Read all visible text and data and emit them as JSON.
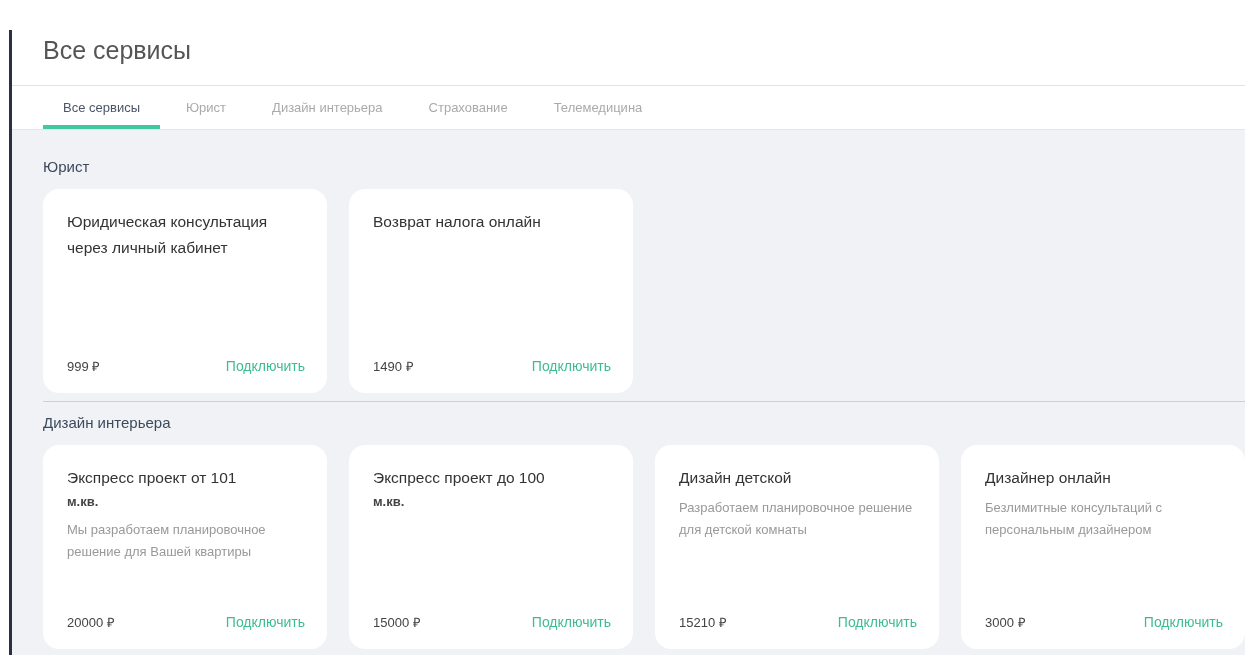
{
  "header": {
    "title": "Все сервисы"
  },
  "tabs": [
    {
      "label": "Все сервисы",
      "selected": true
    },
    {
      "label": "Юрист",
      "selected": false
    },
    {
      "label": "Дизайн интерьера",
      "selected": false
    },
    {
      "label": "Страхование",
      "selected": false
    },
    {
      "label": "Телемедицина",
      "selected": false
    }
  ],
  "sections": [
    {
      "title": "Юрист",
      "cards": [
        {
          "title": "Юридическая консультация через личный кабинет",
          "price": "999 ₽",
          "action": "Подключить"
        },
        {
          "title": "Возврат налога онлайн",
          "price": "1490 ₽",
          "action": "Подключить"
        }
      ]
    },
    {
      "title": "Дизайн интерьера",
      "cards": [
        {
          "title": "Экспресс проект от 101",
          "unit": "м.кв.",
          "description": "Мы разработаем планировочное решение для Вашей квартиры",
          "price": "20000 ₽",
          "action": "Подключить"
        },
        {
          "title": "Экспресс проект до 100",
          "unit": "м.кв.",
          "price": "15000 ₽",
          "action": "Подключить"
        },
        {
          "title": "Дизайн детской",
          "description": "Разработаем планировочное решение для детской комнаты",
          "price": "15210 ₽",
          "action": "Подключить"
        },
        {
          "title": "Дизайнер онлайн",
          "description": "Безлимитные консультаций с персональным дизайнером",
          "price": "3000 ₽",
          "action": "Подключить"
        }
      ]
    }
  ]
}
